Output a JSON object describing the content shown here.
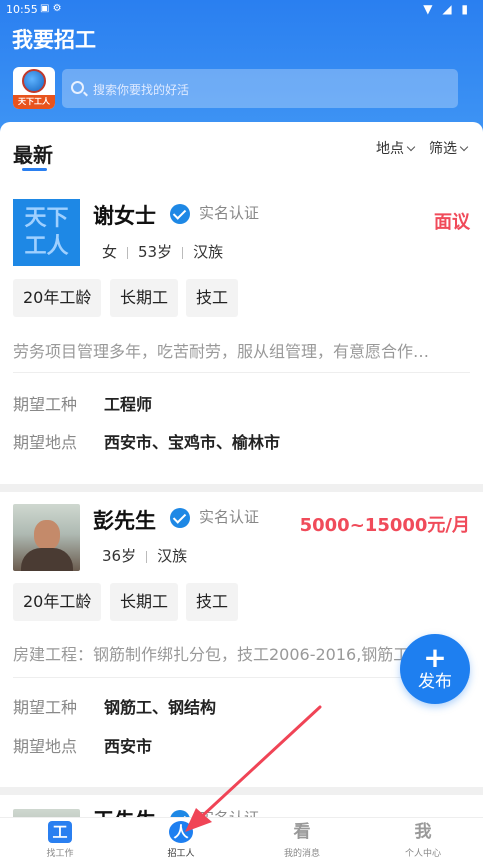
{
  "status_bar": {
    "time": "10:55",
    "icons": "▣ ⚙"
  },
  "header": {
    "title": "我要招工",
    "logo_text": "天下工人"
  },
  "search": {
    "placeholder": "搜索你要找的好活"
  },
  "section": {
    "title": "最新",
    "filter_location": "地点",
    "filter_screen": "筛选"
  },
  "cards": [
    {
      "avatar_text": "天下工人",
      "name": "谢女士",
      "verified": "实名认证",
      "salary": "面议",
      "meta": [
        "女",
        "53岁",
        "汉族"
      ],
      "tags": [
        "20年工龄",
        "长期工",
        "技工"
      ],
      "description": "劳务项目管理多年，吃苦耐劳，服从组管理，有意愿合作…",
      "rows": [
        {
          "label": "期望工种",
          "value": "工程师"
        },
        {
          "label": "期望地点",
          "value": "西安市、宝鸡市、榆林市"
        }
      ]
    },
    {
      "name": "彭先生",
      "verified": "实名认证",
      "salary": "5000~15000元/月",
      "meta": [
        "36岁",
        "汉族"
      ],
      "tags": [
        "20年工龄",
        "长期工",
        "技工"
      ],
      "description": "房建工程：钢筋制作绑扎分包，技工2006-2016,钢筋工…",
      "rows": [
        {
          "label": "期望工种",
          "value": "钢筋工、钢结构"
        },
        {
          "label": "期望地点",
          "value": "西安市"
        }
      ]
    },
    {
      "name": "王先生",
      "verified": "实名认证"
    }
  ],
  "fab": {
    "icon": "+",
    "label": "发布"
  },
  "tabs": [
    {
      "icon": "工",
      "label": "找工作"
    },
    {
      "icon": "人",
      "label": "招工人"
    },
    {
      "icon": "看",
      "label": "我的消息"
    },
    {
      "icon": "我",
      "label": "个人中心"
    }
  ],
  "colors": {
    "primary": "#1e7ff0",
    "salary": "#f04b5a",
    "tag_bg": "#f3f3f3"
  }
}
